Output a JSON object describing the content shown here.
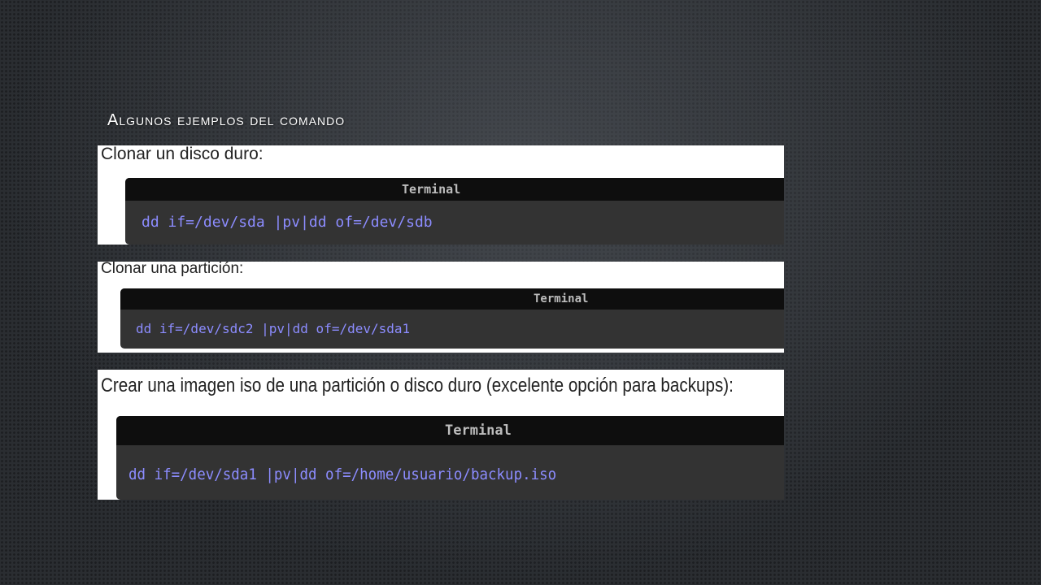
{
  "slide": {
    "title": "Algunos ejemplos del comando"
  },
  "examples": [
    {
      "label": "Clonar un disco duro:",
      "terminal_title": "Terminal",
      "command": "dd if=/dev/sda |pv|dd of=/dev/sdb"
    },
    {
      "label": "Clonar una partición:",
      "terminal_title": "Terminal",
      "command": "dd if=/dev/sdc2 |pv|dd of=/dev/sda1"
    },
    {
      "label": "Crear una imagen iso de una partición o disco duro (excelente opción para backups):",
      "terminal_title": "Terminal",
      "command": "dd if=/dev/sda1 |pv|dd of=/home/usuario/backup.iso"
    }
  ],
  "colors": {
    "command_text": "#8c8cff",
    "terminal_bg": "#333333",
    "terminal_bar": "#0e0e0e"
  }
}
